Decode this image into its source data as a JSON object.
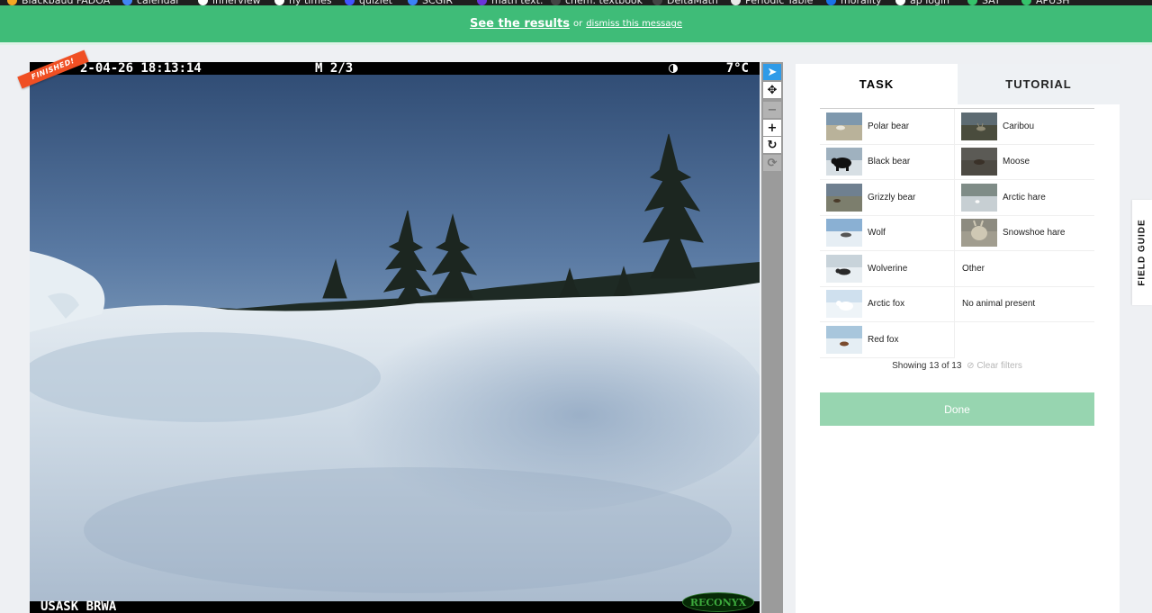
{
  "bookmarks": [
    {
      "label": "Blackbaud FADOA",
      "icon": "blackbaud-icon",
      "color": "#f4a623"
    },
    {
      "label": "calendar",
      "icon": "calendar-icon",
      "color": "#4285f4"
    },
    {
      "label": "innerview",
      "icon": "innerview-icon",
      "color": "#ffffff"
    },
    {
      "label": "ny times",
      "icon": "nytimes-icon",
      "color": "#ffffff"
    },
    {
      "label": "quizlet",
      "icon": "quizlet-icon",
      "color": "#4255ff"
    },
    {
      "label": "SCGIR",
      "icon": "scgir-icon",
      "color": "#3b82f6"
    },
    {
      "label": "math text.",
      "icon": "mathtext-icon",
      "color": "#6a35d9"
    },
    {
      "label": "chem. textbook",
      "icon": "chem-textbook-icon",
      "color": "#444444"
    },
    {
      "label": "DeltaMath",
      "icon": "deltamath-icon",
      "color": "#444444"
    },
    {
      "label": "Periodic Table",
      "icon": "periodic-table-icon",
      "color": "#e8e8e8"
    },
    {
      "label": "morality",
      "icon": "morality-icon",
      "color": "#1a73e8"
    },
    {
      "label": "ap login",
      "icon": "ap-login-icon",
      "color": "#ffffff"
    },
    {
      "label": "SAT",
      "icon": "sat-icon",
      "color": "#35c36b"
    },
    {
      "label": "APUSH",
      "icon": "apush-icon",
      "color": "#35c36b"
    }
  ],
  "banner": {
    "see_results": "See the results",
    "or_text": "or",
    "dismiss": "dismiss this message",
    "color": "#3fbc78"
  },
  "subject": {
    "finished_label": "FINISHED!",
    "datetime": "2-04-26 18:13:14",
    "sequence": "M 2/3",
    "temperature": "7°C",
    "camera_id": "USASK BRWA",
    "brand": "RECONYX"
  },
  "toolbar": [
    {
      "name": "pointer-tool",
      "icon": "cursor-arrow-icon",
      "glyph": "➤",
      "state": "active"
    },
    {
      "name": "move-tool",
      "icon": "move-arrows-icon",
      "glyph": "✥",
      "state": "normal"
    },
    {
      "name": "zoom-out-tool",
      "icon": "minus-icon",
      "glyph": "−",
      "state": "disabled"
    },
    {
      "name": "zoom-in-tool",
      "icon": "plus-icon",
      "glyph": "+",
      "state": "normal"
    },
    {
      "name": "rotate-tool",
      "icon": "rotate-icon",
      "glyph": "↻",
      "state": "normal"
    },
    {
      "name": "reset-tool",
      "icon": "reset-icon",
      "glyph": "⟳",
      "state": "disabled"
    }
  ],
  "tabs": [
    {
      "label": "TASK",
      "active": true
    },
    {
      "label": "TUTORIAL",
      "active": false
    }
  ],
  "choices": [
    {
      "label": "Polar bear",
      "thumb": "polar-bear"
    },
    {
      "label": "Caribou",
      "thumb": "caribou"
    },
    {
      "label": "Black bear",
      "thumb": "black-bear"
    },
    {
      "label": "Moose",
      "thumb": "moose"
    },
    {
      "label": "Grizzly bear",
      "thumb": "grizzly-bear"
    },
    {
      "label": "Arctic hare",
      "thumb": "arctic-hare"
    },
    {
      "label": "Wolf",
      "thumb": "wolf"
    },
    {
      "label": "Snowshoe hare",
      "thumb": "snowshoe-hare"
    },
    {
      "label": "Wolverine",
      "thumb": "wolverine"
    },
    {
      "label": "Other",
      "thumb": ""
    },
    {
      "label": "Arctic fox",
      "thumb": "arctic-fox"
    },
    {
      "label": "No animal present",
      "thumb": ""
    },
    {
      "label": "Red fox",
      "thumb": "red-fox"
    }
  ],
  "filter": {
    "showing": "Showing 13 of 13",
    "clear": "Clear filters"
  },
  "done_label": "Done",
  "field_guide_label": "FIELD GUIDE"
}
